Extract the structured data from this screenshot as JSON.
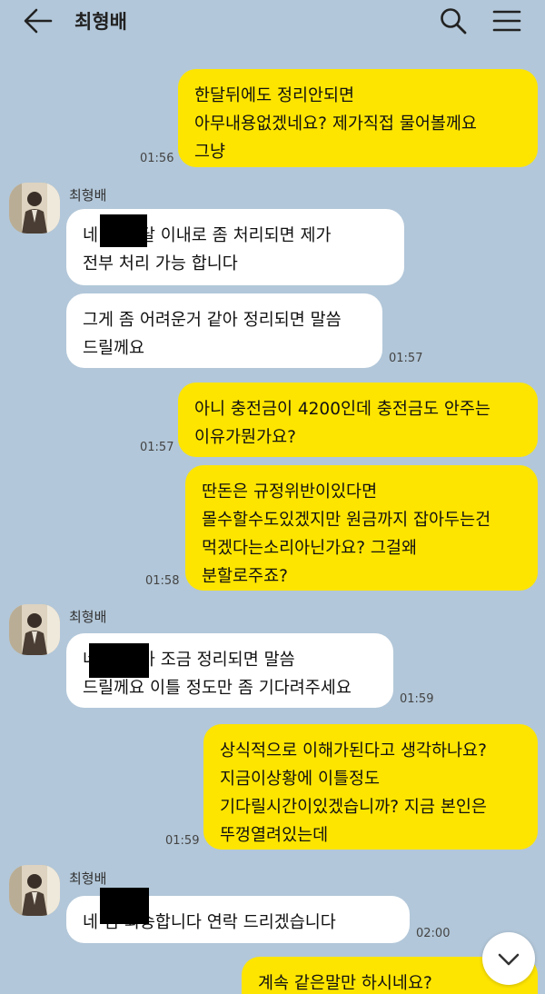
{
  "header": {
    "title": "최형배",
    "icons": {
      "back": "arrow-left-icon",
      "search": "search-icon",
      "menu": "hamburger-menu-icon"
    }
  },
  "colors": {
    "background": "#b2c7d9",
    "my_bubble": "#fee500",
    "their_bubble": "#ffffff"
  },
  "messages": [
    {
      "from": "me",
      "lines": [
        "한달뒤에도 정리안되면",
        "아무내용없겠네요? 제가직접 물어볼께요",
        "그냥"
      ],
      "time": "01:56"
    },
    {
      "from": "them",
      "sender": "최형배",
      "lines": [
        "네         님 한달 이내로 좀 처리되면 제가",
        "전부 처리 가능 합니다"
      ],
      "redacted": true
    },
    {
      "from": "them",
      "lines": [
        "그게 좀 어려운거 같아 정리되면 말씀",
        "드릴께요"
      ],
      "time": "01:57"
    },
    {
      "from": "me",
      "lines": [
        "아니 충전금이 4200인데 충전금도 안주는",
        "이유가뭔가요?"
      ],
      "time": "01:57"
    },
    {
      "from": "me",
      "lines": [
        "딴돈은 규정위반이있다면",
        "몰수할수도있겠지만 원금까지 잡아두는건",
        "먹겠다는소리아닌가요? 그걸왜",
        "분할로주죠?"
      ],
      "time": "01:58"
    },
    {
      "from": "them",
      "sender": "최형배",
      "lines": [
        "네         님 제가 조금 정리되면 말씀",
        "드릴께요 이틀 정도만 좀 기다려주세요"
      ],
      "time": "01:59",
      "redacted": true
    },
    {
      "from": "me",
      "lines": [
        "상식적으로 이해가된다고 생각하나요?",
        "지금이상황에 이틀정도",
        "기다릴시간이있겠습니까? 지금 본인은",
        "뚜껑열려있는데"
      ],
      "time": "01:59"
    },
    {
      "from": "them",
      "sender": "최형배",
      "lines": [
        "네         님 죄송합니다 연락 드리겠습니다"
      ],
      "time": "02:00",
      "redacted": true
    },
    {
      "from": "me",
      "lines": [
        "계속 같은말만 하시네요?"
      ]
    }
  ],
  "scroll_button": {
    "icon": "chevron-down-icon"
  }
}
